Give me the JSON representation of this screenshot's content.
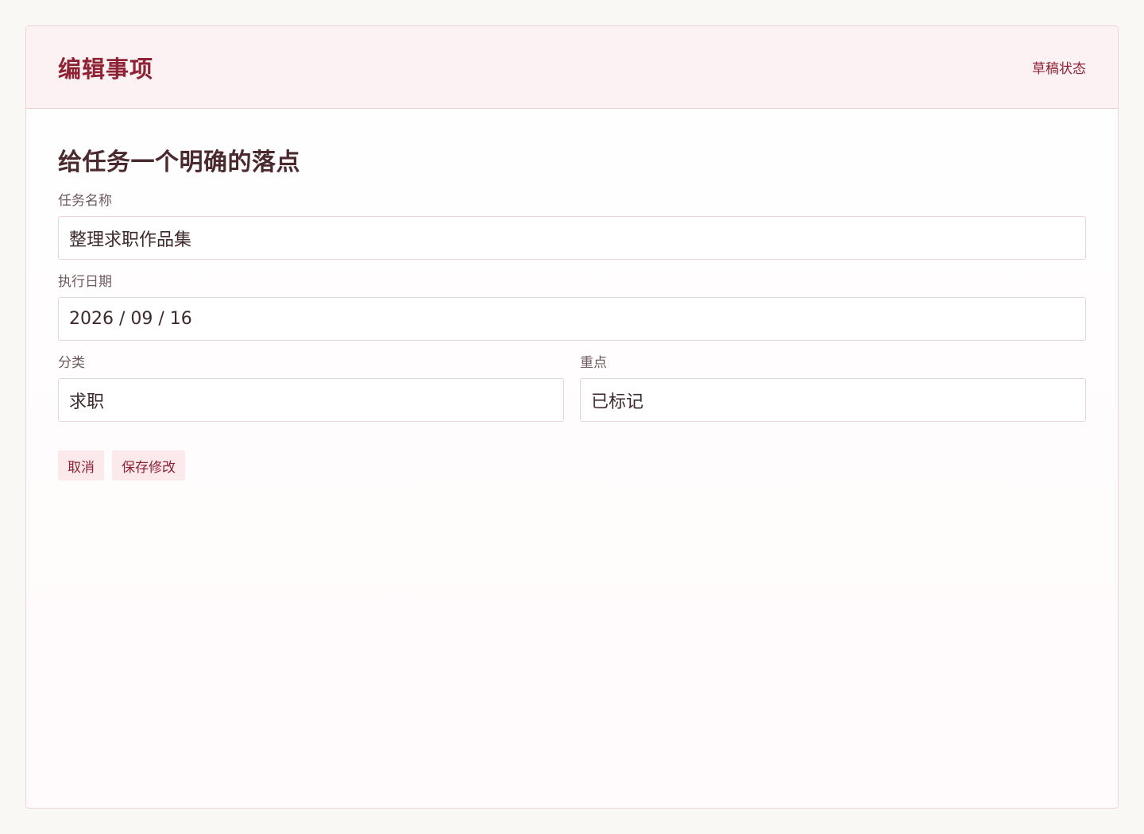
{
  "header": {
    "title": "编辑事项",
    "status": "草稿状态"
  },
  "form": {
    "heading": "给任务一个明确的落点",
    "task_name": {
      "label": "任务名称",
      "value": "整理求职作品集"
    },
    "date": {
      "label": "执行日期",
      "value": "2026 / 09 / 16"
    },
    "category": {
      "label": "分类",
      "value": "求职"
    },
    "priority": {
      "label": "重点",
      "value": "已标记"
    }
  },
  "actions": {
    "cancel_label": "取消",
    "save_label": "保存修改"
  },
  "colors": {
    "accent": "#8e2335",
    "header_bg": "#fdf2f3",
    "page_bg": "#faf8f5",
    "button_bg": "#fbe9ec"
  }
}
